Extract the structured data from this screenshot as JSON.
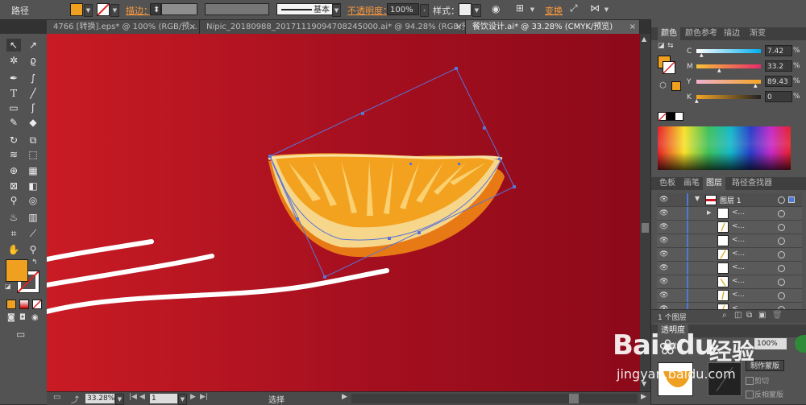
{
  "control_bar": {
    "object_type": "路径",
    "fill_color": "#f0a020",
    "stroke_label": "描边：",
    "stroke_style": "基本",
    "opacity_label": "不透明度：",
    "opacity_value": "100%",
    "style_label": "样式：",
    "transform_label": "变换"
  },
  "doc_tabs": [
    {
      "label": "4766 [转换].eps* @ 100% (RGB/预..."
    },
    {
      "label": "Nipic_20180988_20171119094708245000.ai* @ 94.28% (RGB/预..."
    },
    {
      "label": "餐饮设计.ai* @ 33.28% (CMYK/预览)"
    }
  ],
  "close_glyph": "×",
  "toolbox": {
    "fill_color": "#f0a020",
    "icons": [
      "selection-tool-icon",
      "direct-selection-tool-icon",
      "magic-wand-icon",
      "lasso-icon",
      "pen-tool-icon",
      "curvature-tool-icon",
      "type-tool-icon",
      "line-tool-icon",
      "rectangle-tool-icon",
      "brush-tool-icon",
      "pencil-tool-icon",
      "eraser-tool-icon",
      "rotate-tool-icon",
      "scale-tool-icon",
      "warp-tool-icon",
      "free-transform-icon",
      "shape-builder-icon",
      "perspective-grid-icon",
      "mesh-tool-icon",
      "gradient-tool-icon",
      "eyedropper-tool-icon",
      "blend-tool-icon",
      "symbol-sprayer-icon",
      "column-graph-icon",
      "artboard-tool-icon",
      "slice-tool-icon",
      "hand-tool-icon",
      "zoom-tool-icon"
    ]
  },
  "color_panel": {
    "tabs": [
      "颜色",
      "颜色参考",
      "描边",
      "渐变"
    ],
    "channels": [
      {
        "name": "C",
        "value": "7.42"
      },
      {
        "name": "M",
        "value": "33.2"
      },
      {
        "name": "Y",
        "value": "89.43"
      },
      {
        "name": "K",
        "value": "0"
      }
    ],
    "pct": "%"
  },
  "layers_panel": {
    "tabs": [
      "色板",
      "画笔",
      "图层",
      "路径查找器"
    ],
    "layer_name": "图层 1",
    "sublayer_label": "<...",
    "footer": "1 个图层"
  },
  "transparency_panel": {
    "title": "透明度",
    "mode": "正常",
    "opacity": "100%",
    "make_mask": "制作蒙版",
    "clip": "剪切",
    "invert_mask": "反相蒙版"
  },
  "status_bar": {
    "zoom": "33.28%",
    "page": "1",
    "tool": "选择"
  },
  "watermark": {
    "brand": "Bai",
    "brand2": "du",
    "brand_cn": "经验",
    "url": "jingyan.baidu.com"
  },
  "colors": {
    "canvas_left": "#c91b24",
    "canvas_right": "#8c0a1a",
    "orange_fill": "#f0a020",
    "selection": "#5a74d6"
  }
}
